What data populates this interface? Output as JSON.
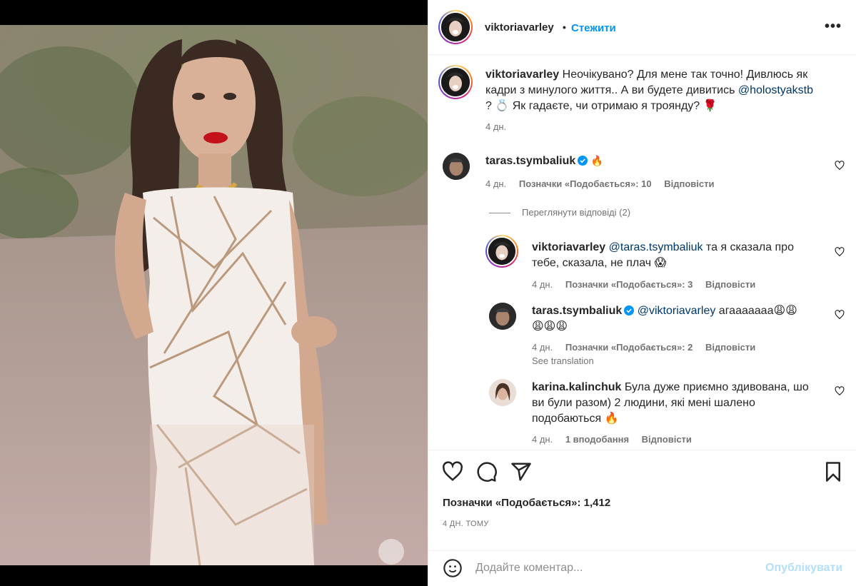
{
  "post": {
    "username": "viktoriavarley",
    "separator": "•",
    "follow_label": "Стежити",
    "more_label": "•••"
  },
  "caption": {
    "username": "viktoriavarley",
    "text_1": "Неочікувано? Для мене так точно! Дивлюсь як",
    "text_2a": "кадри з минулого життя.. А ви будете дивитись ",
    "mention": "@holostyakstb",
    "text_3": "? 💍 Як гадаєте, чи отримаю я троянду? 🌹",
    "time": "4 дн."
  },
  "comments": [
    {
      "username": "taras.tsymbaliuk",
      "text": "🔥",
      "time": "4 дн.",
      "likes": "Позначки «Подобається»: 10",
      "reply": "Відповісти"
    }
  ],
  "view_replies": "Переглянути відповіді (2)",
  "replies": [
    {
      "username": "viktoriavarley",
      "mention": "@taras.tsymbaliuk",
      "text_1": " та я сказала про",
      "text_2": "тебе, сказала, не плач 😱",
      "time": "4 дн.",
      "likes": "Позначки «Подобається»: 3",
      "reply": "Відповісти"
    },
    {
      "username": "taras.tsymbaliuk",
      "mention": "@viktoriavarley",
      "text_1": " агааааааа😩😩",
      "text_2": "😩😩😩",
      "time": "4 дн.",
      "likes": "Позначки «Подобається»: 2",
      "reply": "Відповісти",
      "translation": "See translation"
    },
    {
      "username": "karina.kalinchuk",
      "text_1": " Була дуже приємно здивована, шо",
      "text_2": "ви були разом) 2 людини, які мені шалено",
      "text_3": "подобаються 🔥",
      "time": "4 дн.",
      "likes": "1 вподобання",
      "reply": "Відповісти"
    }
  ],
  "footer": {
    "likes": "Позначки «Подобається»: 1,412",
    "date": "4 ДН. ТОМУ",
    "comment_placeholder": "Додайте коментар...",
    "post_label": "Опублікувати"
  },
  "icons": {
    "like": "heart-icon",
    "comment": "comment-icon",
    "share": "share-icon",
    "save": "bookmark-icon",
    "emoji": "smile-icon",
    "verified": "verified-badge-icon"
  },
  "colors": {
    "accent": "#0095f6",
    "mention": "#00376b",
    "muted": "#737373",
    "post_disabled": "#b2dffc",
    "verified": "#0095f6",
    "fire": "#ff6a00"
  }
}
